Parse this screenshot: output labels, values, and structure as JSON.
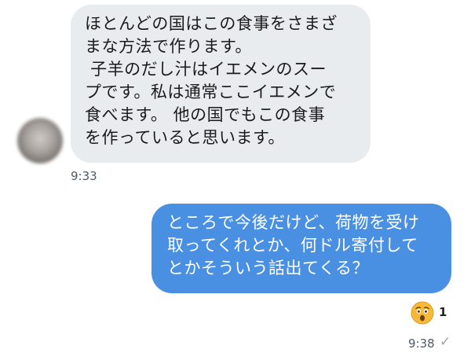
{
  "incoming_message": {
    "text": "ほとんどの国はこの食事をさまざ\nまな方法で作ります。\n 子羊のだし汁はイエメンのスー\nプです。私は通常ここイエメンで\n食べます。 他の国でもこの食事\nを作っていると思います。",
    "time": "9:33"
  },
  "outgoing_message": {
    "text": "ところで今後だけど、荷物を受け\n取ってくれとか、何ドル寄付して\nとかそういう話出てくる？",
    "time": "9:38",
    "status_icon": "✓"
  },
  "reaction": {
    "icon": "astonished-face-icon",
    "count": "1"
  },
  "colors": {
    "incoming_bubble": "#e9ecef",
    "outgoing_bubble": "#4a90e2",
    "timestamp": "#4f5a66"
  }
}
